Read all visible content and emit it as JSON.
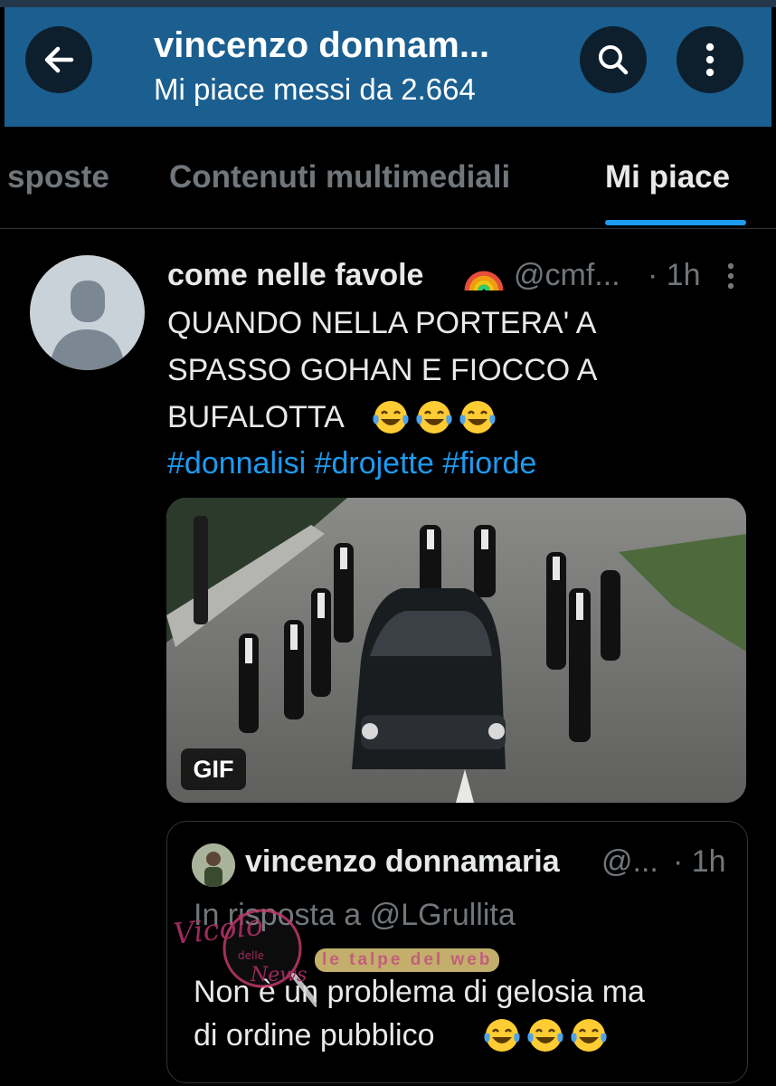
{
  "header": {
    "title": "vincenzo donnam...",
    "subtitle": "Mi piace messi da 2.664",
    "back_icon": "arrow-left-icon",
    "search_icon": "search-icon",
    "more_icon": "more-vertical-icon",
    "background_color": "#1b5f91"
  },
  "tabs": [
    {
      "label": "sposte",
      "active": false
    },
    {
      "label": "Contenuti multimediali",
      "active": false
    },
    {
      "label": "Mi piace",
      "active": true
    }
  ],
  "tweet": {
    "author_name": "come nelle favole",
    "name_emoji": "rainbow",
    "handle": "@cmf...",
    "time": "· 1h",
    "text_lines": [
      "QUANDO NELLA PORTERA' A",
      "SPASSO GOHAN E FIOCCO A",
      "BUFALOTTA"
    ],
    "text_emojis": [
      "face-with-tears-of-joy",
      "face-with-tears-of-joy",
      "face-with-tears-of-joy"
    ],
    "hashtags": "#donnalisi #drojette #fiorde",
    "media_badge": "GIF",
    "quoted": {
      "author_name": "vincenzo donnamaria",
      "handle": "@...",
      "time": "· 1h",
      "reply_to": "In risposta a @LGrullita",
      "text_lines": [
        "Non è un problema di gelosia ma",
        "di ordine pubblico"
      ],
      "text_emojis": [
        "face-with-tears-of-joy",
        "face-with-tears-of-joy",
        "face-with-tears-of-joy"
      ]
    }
  },
  "watermark": {
    "stamp_text": [
      "Vicolo",
      "delle",
      "News"
    ],
    "banner": "le talpe del web"
  },
  "colors": {
    "accent": "#1d9bf0",
    "text": "#e7e9ea",
    "muted": "#71767b",
    "background": "#000000"
  }
}
